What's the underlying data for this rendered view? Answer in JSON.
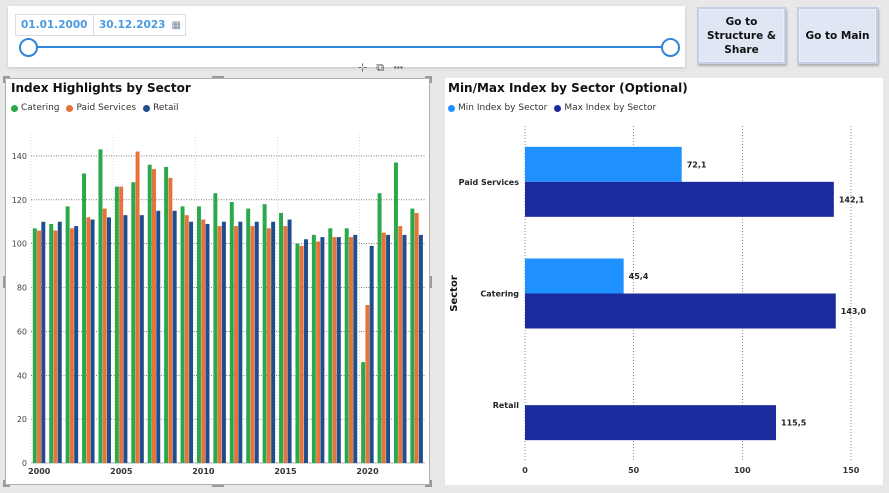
{
  "slicer": {
    "start_date": "01.01.2000",
    "end_date": "30.12.2023",
    "calendar_icon": "calendar-icon"
  },
  "buttons": {
    "structure_label": "Go to Structure & Share",
    "main_label": "Go to Main"
  },
  "visual_header_icons": [
    "filter-icon",
    "focus-mode-icon",
    "more-options-icon"
  ],
  "colors": {
    "catering": "#2aa84a",
    "paid_services": "#e8733a",
    "retail": "#1f4e8c",
    "min_index": "#1e90ff",
    "max_index": "#1b2a9c",
    "slider": "#2f86d8"
  },
  "left_chart": {
    "title": "Index Highlights by Sector",
    "legend": [
      "Catering",
      "Paid Services",
      "Retail"
    ]
  },
  "right_chart": {
    "title": "Min/Max Index by Sector (Optional)",
    "legend": [
      "Min Index by Sector",
      "Max Index by Sector"
    ],
    "ylabel": "Sector"
  },
  "chart_data": [
    {
      "type": "bar",
      "title": "Index Highlights by Sector",
      "x": [
        2000,
        2001,
        2002,
        2003,
        2004,
        2005,
        2006,
        2007,
        2008,
        2009,
        2010,
        2011,
        2012,
        2013,
        2014,
        2015,
        2016,
        2017,
        2018,
        2019,
        2020,
        2021,
        2022,
        2023
      ],
      "series": [
        {
          "name": "Catering",
          "values": [
            107,
            109,
            117,
            132,
            143,
            126,
            128,
            136,
            135,
            117,
            117,
            123,
            119,
            116,
            118,
            114,
            100,
            104,
            107,
            107,
            46,
            123,
            137,
            116
          ]
        },
        {
          "name": "Paid Services",
          "values": [
            106,
            106,
            107,
            112,
            116,
            126,
            142,
            134,
            130,
            113,
            111,
            108,
            108,
            108,
            107,
            108,
            99,
            101,
            103,
            103,
            72,
            105,
            108,
            114
          ]
        },
        {
          "name": "Retail",
          "values": [
            110,
            110,
            108,
            111,
            112,
            113,
            113,
            115,
            115,
            110,
            109,
            110,
            110,
            110,
            110,
            111,
            102,
            103,
            103,
            104,
            99,
            104,
            104,
            104
          ]
        }
      ],
      "xticks": [
        2000,
        2005,
        2010,
        2015,
        2020
      ],
      "yticks": [
        0,
        20,
        40,
        60,
        80,
        100,
        120,
        140
      ],
      "ylim": [
        0,
        150
      ],
      "grid": true,
      "legend_position": "top-left"
    },
    {
      "type": "bar",
      "orientation": "horizontal",
      "title": "Min/Max Index by Sector (Optional)",
      "categories": [
        "Paid Services",
        "Catering",
        "Retail"
      ],
      "series": [
        {
          "name": "Min Index by Sector",
          "values": [
            72.1,
            45.4,
            null
          ]
        },
        {
          "name": "Max Index by Sector",
          "values": [
            142.1,
            143.0,
            115.5
          ]
        }
      ],
      "data_labels": [
        [
          "72,1",
          "45,4",
          ""
        ],
        [
          "142,1",
          "143,0",
          "115,5"
        ]
      ],
      "ylabel": "Sector",
      "xticks": [
        0,
        50,
        100,
        150
      ],
      "xlim": [
        0,
        150
      ],
      "grid": true,
      "legend_position": "top-left"
    }
  ]
}
